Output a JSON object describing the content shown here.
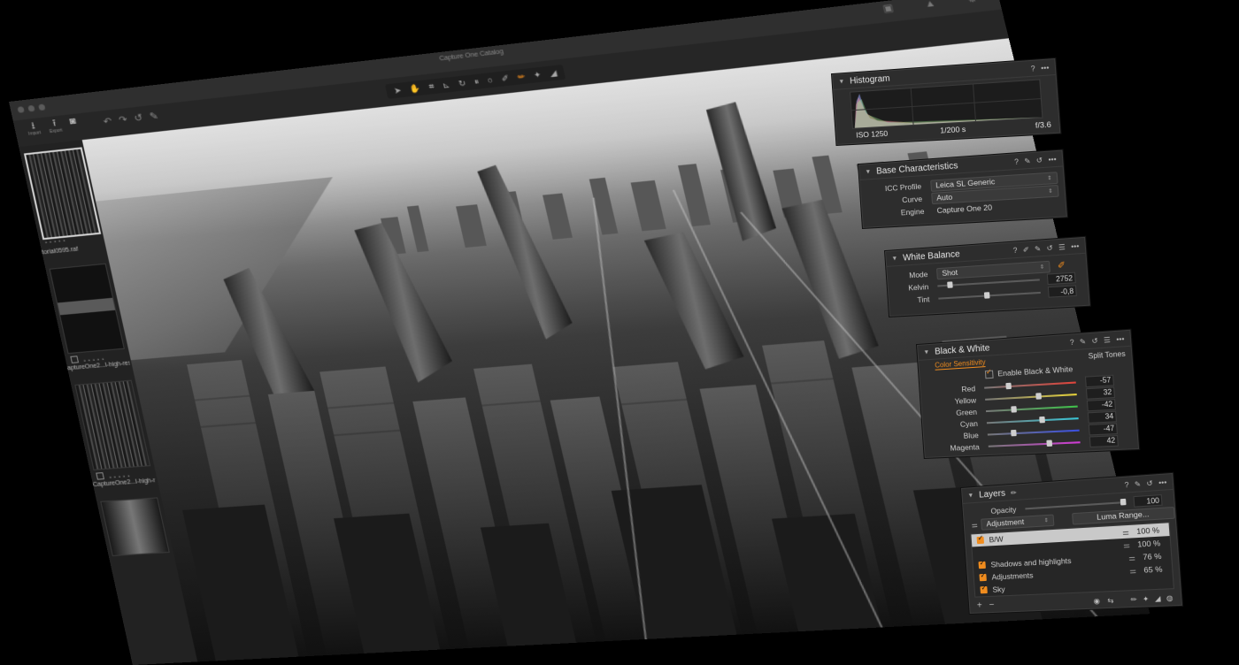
{
  "window": {
    "catalog_title": "Capture One Catalog"
  },
  "toolbar": {
    "import_label": "Import",
    "export_label": "Export",
    "cursor_tools_icons": [
      "pointer-icon",
      "hand-icon",
      "crop-icon",
      "straighten-icon",
      "rotate-icon",
      "keystone-icon",
      "spot-icon",
      "color-picker-icon",
      "brush-icon",
      "eraser-icon",
      "gradient-icon"
    ]
  },
  "browser": {
    "items": [
      {
        "label": "torial0595.raf"
      },
      {
        "label": "aptureOne2...l-high-res5.tif"
      },
      {
        "label": "CaptureOne2...l-high-res6.tif"
      }
    ]
  },
  "histogram": {
    "title": "Histogram",
    "iso": "ISO 1250",
    "shutter": "1/200 s",
    "aperture": "f/3.6"
  },
  "base_characteristics": {
    "title": "Base Characteristics",
    "icc_label": "ICC Profile",
    "icc_value": "Leica SL Generic",
    "curve_label": "Curve",
    "curve_value": "Auto",
    "engine_label": "Engine",
    "engine_value": "Capture One 20"
  },
  "white_balance": {
    "title": "White Balance",
    "mode_label": "Mode",
    "mode_value": "Shot",
    "kelvin_label": "Kelvin",
    "kelvin_value": "2752",
    "kelvin_level": 0.1,
    "tint_label": "Tint",
    "tint_value": "-0,8",
    "tint_level": 0.48
  },
  "black_white": {
    "title": "Black & White",
    "tab_color": "Color Sensitivity",
    "tab_split": "Split Tones",
    "enable_label": "Enable Black & White",
    "sliders": [
      {
        "name": "Red",
        "value": "-57",
        "level": 0.25,
        "color": "#e0433a"
      },
      {
        "name": "Yellow",
        "value": "32",
        "level": 0.6,
        "color": "#e6d23a"
      },
      {
        "name": "Green",
        "value": "-42",
        "level": 0.3,
        "color": "#3fc24a"
      },
      {
        "name": "Cyan",
        "value": "34",
        "level": 0.62,
        "color": "#3ac6d6"
      },
      {
        "name": "Blue",
        "value": "-47",
        "level": 0.28,
        "color": "#3a4fe0"
      },
      {
        "name": "Magenta",
        "value": "42",
        "level": 0.68,
        "color": "#d03ad6"
      }
    ]
  },
  "layers": {
    "title": "Layers",
    "opacity_label": "Opacity",
    "opacity_value": "100",
    "adjustment_select": "Adjustment",
    "luma_button": "Luma Range...",
    "items": [
      {
        "name": "B/W",
        "pct": "100 %",
        "selected": true
      },
      {
        "name": "",
        "pct": "100 %",
        "selected": false
      },
      {
        "name": "Shadows and highlights",
        "pct": "76 %",
        "selected": false
      },
      {
        "name": "Adjustments",
        "pct": "65 %",
        "selected": false
      },
      {
        "name": "Sky",
        "pct": "",
        "selected": false
      }
    ]
  },
  "colors": {
    "accent": "#f08c1e",
    "panel_bg": "#2d2d2d"
  }
}
